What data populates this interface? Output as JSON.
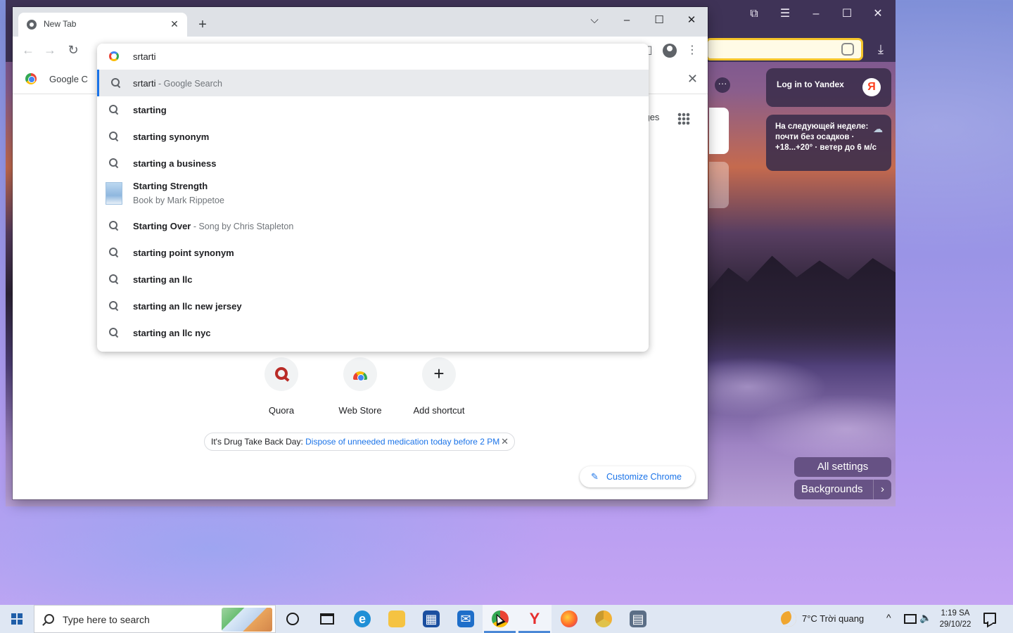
{
  "chrome": {
    "tab_title": "New Tab",
    "bookmark_label": "Google C",
    "images_link": "nages",
    "omnibox_text": "srtarti",
    "suggestions": [
      {
        "text": "srtarti",
        "sub": " - Google Search"
      },
      {
        "text": "starting"
      },
      {
        "text": "starting synonym"
      },
      {
        "text": "starting a business"
      },
      {
        "text": "Starting Strength",
        "line2": "Book by Mark Rippetoe"
      },
      {
        "text": "Starting Over",
        "sub": " - Song by Chris Stapleton"
      },
      {
        "text": "starting point synonym"
      },
      {
        "text": "starting an llc"
      },
      {
        "text": "starting an llc new jersey"
      },
      {
        "text": "starting an llc nyc"
      }
    ],
    "shortcuts": [
      {
        "label": "Quora"
      },
      {
        "label": "Web Store"
      },
      {
        "label": "Add shortcut"
      }
    ],
    "promo": {
      "text": "It's Drug Take Back Day: ",
      "link": "Dispose of unneeded medication today before 2 PM"
    },
    "customize_label": "Customize Chrome"
  },
  "yandex": {
    "login_label": "Log in to Yandex",
    "logo_letter": "Я",
    "weather_text": "На следующей неделе: почти без осадков · +18...+20° · ветер до 6 м/с",
    "all_settings": "All settings",
    "backgrounds": "Backgrounds"
  },
  "taskbar": {
    "search_placeholder": "Type here to search",
    "weather": "7°C  Trời quang",
    "time": "1:19 SA",
    "date": "29/10/22"
  },
  "colors": {
    "accent": "#1a73e8",
    "yandex_address_border": "#f5c52b",
    "taskbar": "#dfe7f3"
  }
}
